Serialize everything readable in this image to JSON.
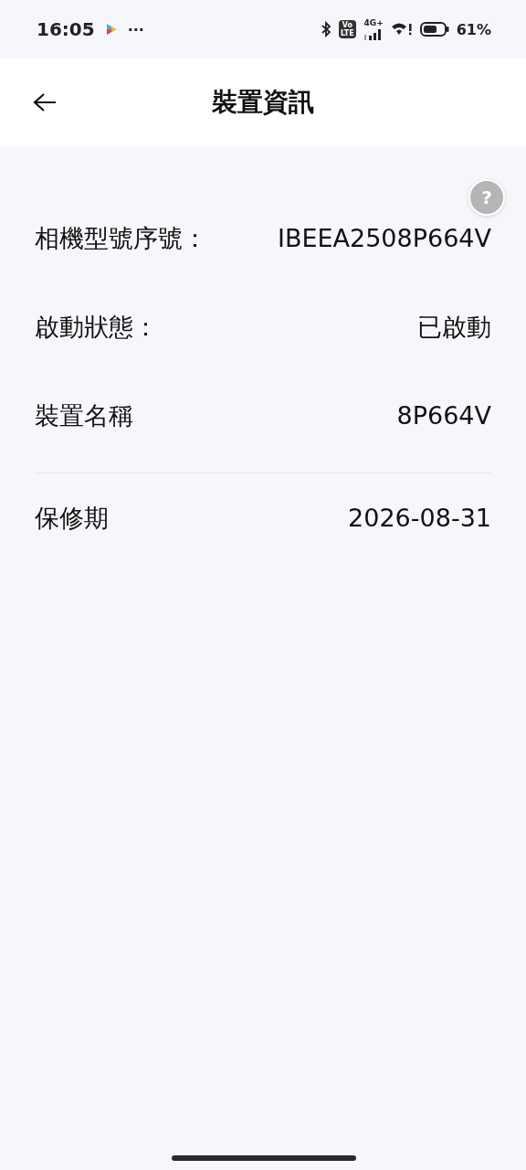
{
  "status_bar": {
    "time": "16:05",
    "more": "···",
    "volte": [
      "Vo",
      "LTE"
    ],
    "network": "4G+",
    "battery": "61%"
  },
  "header": {
    "title": "裝置資訊"
  },
  "help": {
    "label": "?"
  },
  "sections": [
    {
      "rows": [
        {
          "label": "相機型號序號：",
          "value": "IBEEA2508P664V"
        },
        {
          "label": "啟動狀態：",
          "value": "已啟動"
        },
        {
          "label": "裝置名稱",
          "value": "8P664V"
        }
      ]
    },
    {
      "rows": [
        {
          "label": "保修期",
          "value": "2026-08-31"
        }
      ]
    }
  ]
}
